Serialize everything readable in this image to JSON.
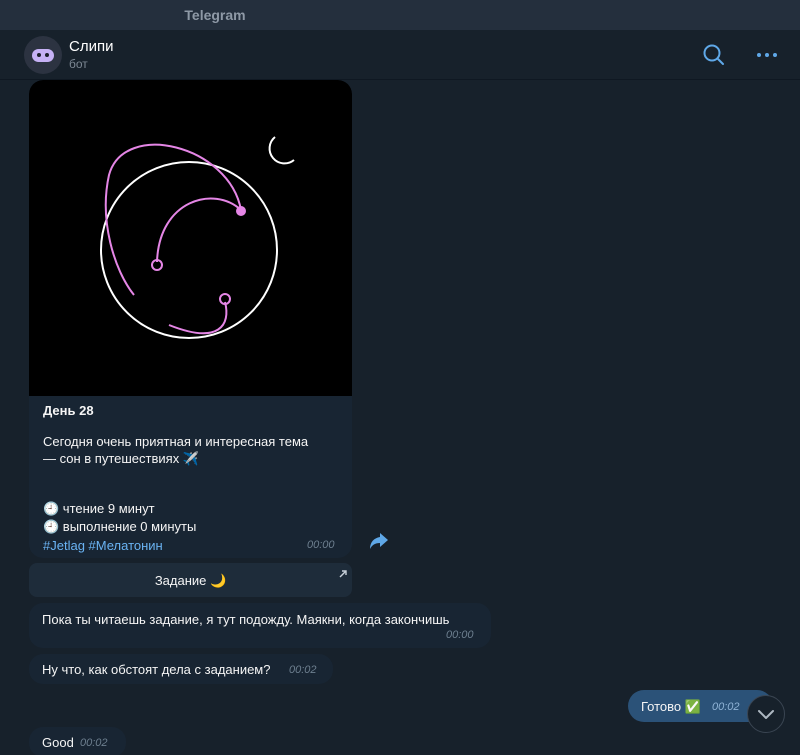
{
  "window": {
    "title": "Telegram"
  },
  "chat": {
    "name": "Слипи",
    "subtitle": "бот"
  },
  "header_icons": {
    "search": "search-icon",
    "more": "more-dots-icon"
  },
  "post": {
    "title": "День 28",
    "text_line1": "Сегодня очень приятная и интересная тема",
    "text_line2": "— сон в путешествиях ✈️",
    "reading": "🕘 чтение 9 минут",
    "doing": "🕘 выполнение 0 минуты",
    "hashtags": "#Jetlag #Мелатонин",
    "time": "00:00"
  },
  "inline_button": {
    "label": "Задание 🌙"
  },
  "messages": [
    {
      "text": "Пока ты читаешь задание, я тут подожду. Маякни, когда закончишь",
      "time": "00:00"
    },
    {
      "text": "Ну что, как обстоят дела с заданием?",
      "time": "00:02"
    },
    {
      "text": "Good",
      "time": "00:02"
    }
  ],
  "outgoing": {
    "text": "Готово ✅",
    "time": "00:02"
  },
  "colors": {
    "accent": "#6ab3f3",
    "illustration_pink": "#e586e6",
    "outgoing_bubble": "#2b5278"
  }
}
